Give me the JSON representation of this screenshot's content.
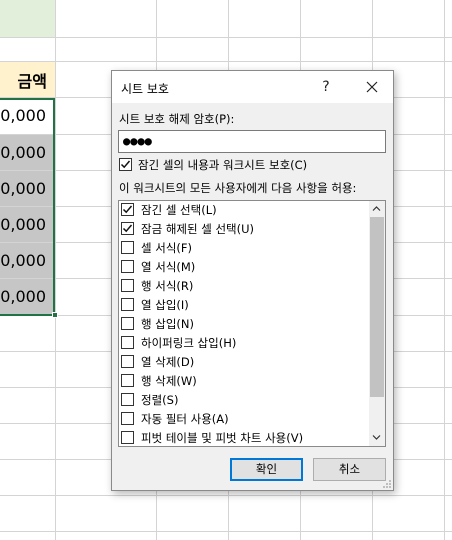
{
  "sheet": {
    "header_text": "금액",
    "values": [
      "0,000",
      "0,000",
      "0,000",
      "0,000",
      "0,000",
      "0,000"
    ]
  },
  "dialog": {
    "title": "시트 보호",
    "help_label": "?",
    "password_label": "시트 보호 해제 암호(P):",
    "password_value": "●●●●",
    "protect_checkbox_label": "잠긴 셀의 내용과 워크시트 보호(C)",
    "protect_checked": true,
    "allow_label": "이 워크시트의 모든 사용자에게 다음 사항을 허용:",
    "options": [
      {
        "label": "잠긴 셀 선택(L)",
        "checked": true
      },
      {
        "label": "잠금 해제된 셀 선택(U)",
        "checked": true
      },
      {
        "label": "셀 서식(F)",
        "checked": false
      },
      {
        "label": "열 서식(M)",
        "checked": false
      },
      {
        "label": "행 서식(R)",
        "checked": false
      },
      {
        "label": "열 삽입(I)",
        "checked": false
      },
      {
        "label": "행 삽입(N)",
        "checked": false
      },
      {
        "label": "하이퍼링크 삽입(H)",
        "checked": false
      },
      {
        "label": "열 삭제(D)",
        "checked": false
      },
      {
        "label": "행 삭제(W)",
        "checked": false
      },
      {
        "label": "정렬(S)",
        "checked": false
      },
      {
        "label": "자동 필터 사용(A)",
        "checked": false
      },
      {
        "label": "피벗 테이블 및 피벗 차트 사용(V)",
        "checked": false
      }
    ],
    "ok_label": "확인",
    "cancel_label": "취소"
  },
  "colors": {
    "selection_border": "#217346",
    "header_fill": "#fff2cc",
    "green_fill": "#e2efda",
    "gray_fill": "#c6c6c6",
    "default_button_border": "#0078d7"
  }
}
